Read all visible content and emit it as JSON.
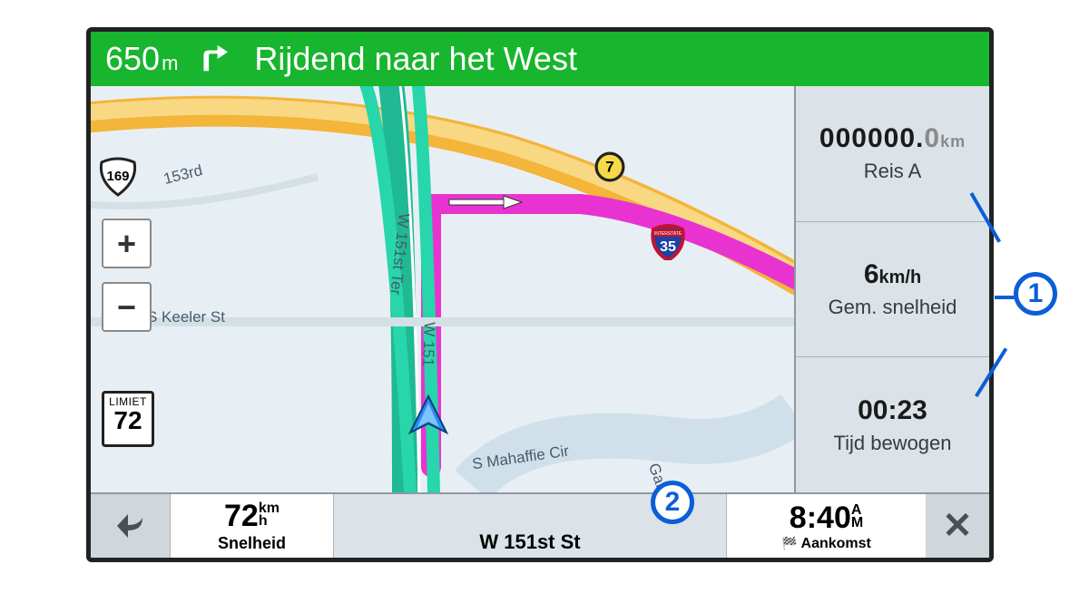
{
  "topbar": {
    "distance_value": "650",
    "distance_unit": "m",
    "direction_text": "Rijdend naar het West"
  },
  "map": {
    "streets": {
      "keeler": "S Keeler St",
      "w151stTer": "W 151st Ter",
      "w151": "W 151",
      "mahaffie": "S Mahaffie Cir",
      "gar": "Gar",
      "road153": "153rd"
    },
    "shields": {
      "us169": "169",
      "hwy7": "7",
      "i35": "35"
    },
    "speed_limit_label": "LIMIET",
    "speed_limit_value": "72"
  },
  "panel": {
    "odometer_value": "000000.",
    "odometer_decimal": "0",
    "odometer_unit": "km",
    "trip_label": "Reis A",
    "avg_speed_value": "6",
    "avg_speed_unit": "km/h",
    "avg_speed_label": "Gem. snelheid",
    "time_moving_value": "00:23",
    "time_moving_label": "Tijd bewogen"
  },
  "bottom": {
    "speed_value": "72",
    "speed_unit_top": "km",
    "speed_unit_bottom": "h",
    "speed_label": "Snelheid",
    "current_street": "W 151st St",
    "eta_value": "8:40",
    "eta_am": "A",
    "eta_pm": "M",
    "eta_label": "Aankomst"
  },
  "annotations": {
    "callout1": "1",
    "callout2": "2"
  }
}
